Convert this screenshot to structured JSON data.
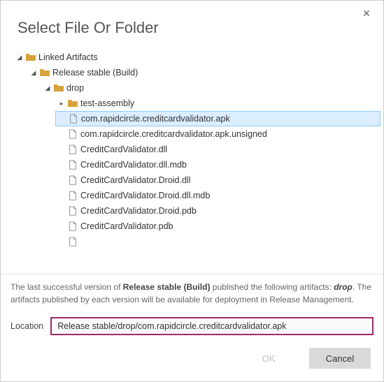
{
  "title": "Select File Or Folder",
  "tree": {
    "root": "Linked Artifacts",
    "release": "Release stable (Build)",
    "drop": "drop",
    "testAssembly": "test-assembly",
    "files": [
      "com.rapidcircle.creditcardvalidator.apk",
      "com.rapidcircle.creditcardvalidator.apk.unsigned",
      "CreditCardValidator.dll",
      "CreditCardValidator.dll.mdb",
      "CreditCardValidator.Droid.dll",
      "CreditCardValidator.Droid.dll.mdb",
      "CreditCardValidator.Droid.pdb",
      "CreditCardValidator.pdb"
    ]
  },
  "info": {
    "pre": "The last successful version of ",
    "bold1": "Release stable (Build)",
    "mid": " published the following artifacts: ",
    "bold2": "drop",
    "post": ". The artifacts published by each version will be available for deployment in Release Management."
  },
  "location": {
    "label": "Location",
    "value": "Release stable/drop/com.rapidcircle.creditcardvalidator.apk"
  },
  "buttons": {
    "ok": "OK",
    "cancel": "Cancel"
  }
}
